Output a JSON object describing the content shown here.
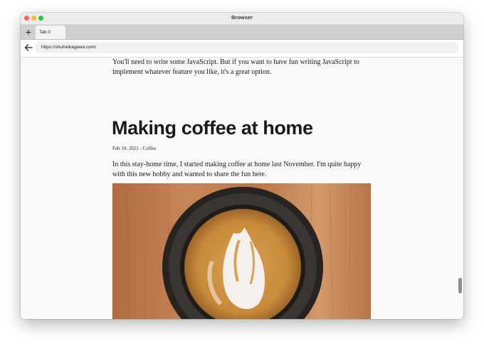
{
  "window": {
    "title": "Browser"
  },
  "tabs": [
    {
      "label": "Tab 0",
      "active": true
    }
  ],
  "toolbar": {
    "new_tab_glyph": "+",
    "url": "https://shuheikagawa.com/"
  },
  "article": {
    "previous_paragraph": "You'll need to write some JavaScript. But if you want to have fun writing JavaScript to implement whatever feature you like, it's a great option.",
    "title": "Making coffee at home",
    "meta": "Feb 10, 2021 - Coffee",
    "body": "In this stay-home time, I started making coffee at home last November. I'm quite happy with this new hobby and wanted to share the fun here."
  },
  "icons": {
    "new_tab": "plus-icon",
    "back": "arrow-left-icon"
  },
  "colors": {
    "close": "#fe5f57",
    "minimize": "#febc2e",
    "zoom": "#28c840"
  }
}
